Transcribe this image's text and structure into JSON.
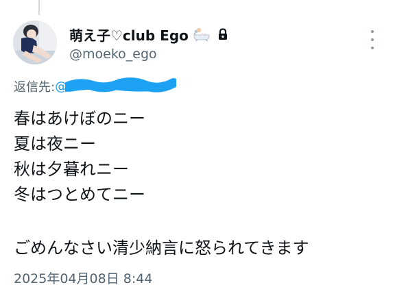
{
  "tweet": {
    "display_name": "萌え子♡club Ego",
    "handle": "@moeko_ego",
    "reply_prefix": "返信先:",
    "reply_handle": "@",
    "lines": [
      "春はあけぼのニー",
      "夏は夜ニー",
      "秋は夕暮れニー",
      "冬はつとめてニー"
    ],
    "apology": "ごめんなさい清少納言に怒られてきます",
    "timestamp": "2025年04月08日 8:44"
  },
  "icons": {
    "name_emoji": "bathtub-icon",
    "protected": "lock-icon",
    "more": "more-options-icon"
  },
  "colors": {
    "text": "#0f1419",
    "secondary": "#536471",
    "link": "#1d9bf0",
    "redaction": "#1da1f2"
  }
}
